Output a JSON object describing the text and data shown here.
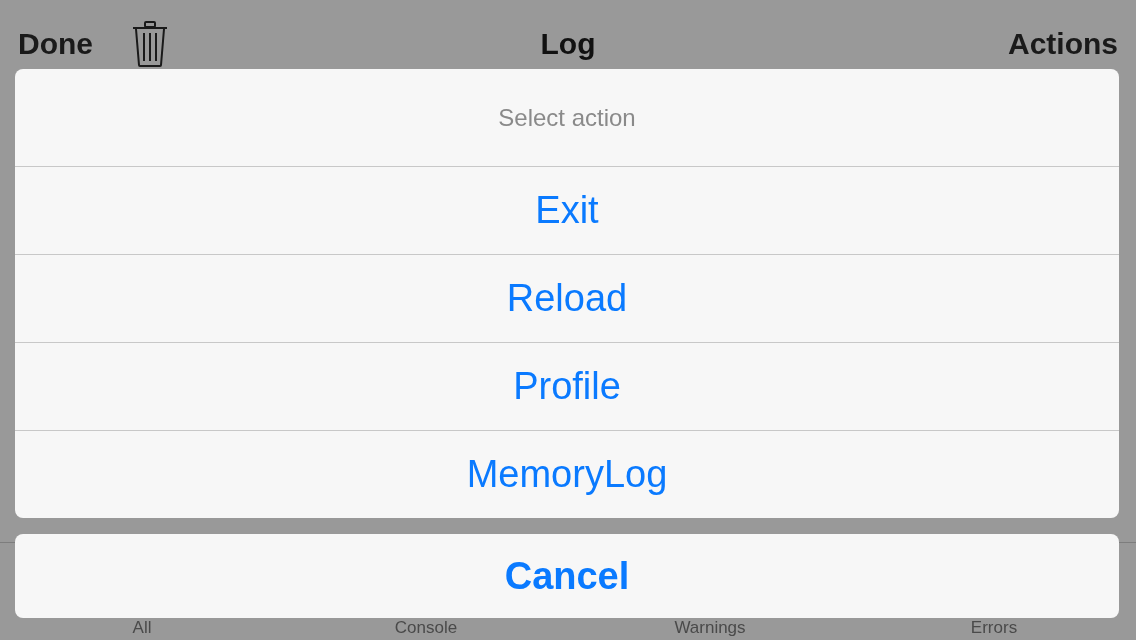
{
  "nav_bar": {
    "left_button": "Done",
    "title": "Log",
    "right_button": "Actions"
  },
  "tab_bar": {
    "tabs": [
      "All",
      "Console",
      "Warnings",
      "Errors"
    ]
  },
  "action_sheet": {
    "title": "Select action",
    "actions": [
      "Exit",
      "Reload",
      "Profile",
      "MemoryLog"
    ],
    "cancel": "Cancel"
  }
}
